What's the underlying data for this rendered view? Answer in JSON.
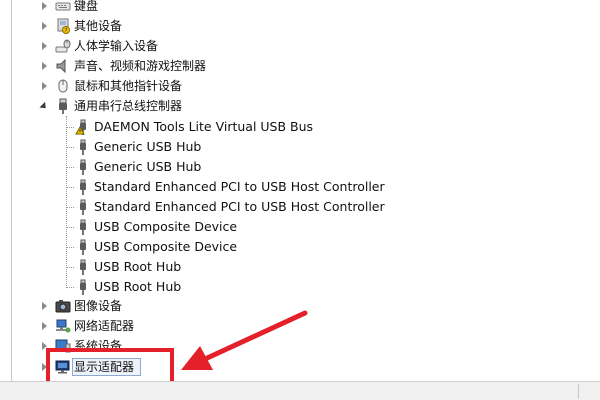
{
  "device_tree": {
    "categories": [
      {
        "label": "键盘",
        "icon": "keyboard-icon",
        "expanded": false
      },
      {
        "label": "其他设备",
        "icon": "unknown-device-icon",
        "expanded": false
      },
      {
        "label": "人体学输入设备",
        "icon": "hid-icon",
        "expanded": false
      },
      {
        "label": "声音、视频和游戏控制器",
        "icon": "speaker-icon",
        "expanded": false
      },
      {
        "label": "鼠标和其他指针设备",
        "icon": "mouse-icon",
        "expanded": false
      },
      {
        "label": "通用串行总线控制器",
        "icon": "usb-icon",
        "expanded": true
      }
    ],
    "usb_children": [
      {
        "label": "DAEMON Tools Lite Virtual USB Bus",
        "icon": "usb-warning-icon"
      },
      {
        "label": "Generic USB Hub",
        "icon": "usb-plug-icon"
      },
      {
        "label": "Generic USB Hub",
        "icon": "usb-plug-icon"
      },
      {
        "label": "Standard Enhanced PCI to USB Host Controller",
        "icon": "usb-plug-icon"
      },
      {
        "label": "Standard Enhanced PCI to USB Host Controller",
        "icon": "usb-plug-icon"
      },
      {
        "label": "USB Composite Device",
        "icon": "usb-plug-icon"
      },
      {
        "label": "USB Composite Device",
        "icon": "usb-plug-icon"
      },
      {
        "label": "USB Root Hub",
        "icon": "usb-plug-icon"
      },
      {
        "label": "USB Root Hub",
        "icon": "usb-plug-icon"
      }
    ],
    "bottom_categories": [
      {
        "label": "图像设备",
        "icon": "camera-icon",
        "expanded": false
      },
      {
        "label": "网络适配器",
        "icon": "network-icon",
        "expanded": false
      },
      {
        "label": "系统设备",
        "icon": "system-icon",
        "expanded": false
      },
      {
        "label": "显示适配器",
        "icon": "monitor-icon",
        "expanded": false,
        "selected": true
      }
    ]
  },
  "annotation": {
    "highlight_color": "#e4202a",
    "arrow_color": "#e4202a"
  }
}
